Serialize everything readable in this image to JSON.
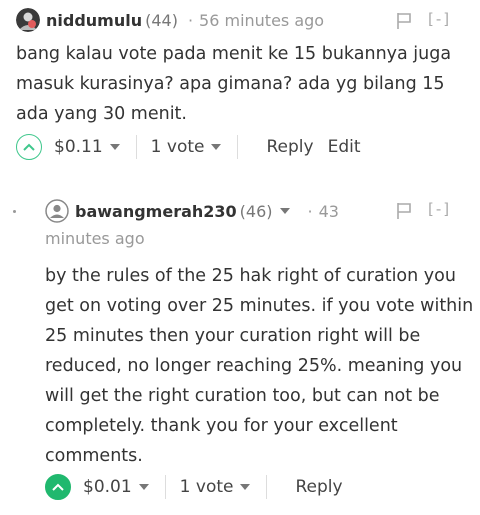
{
  "comments": [
    {
      "author": "niddumulu",
      "reputation": "(44)",
      "separator": "·",
      "time": "56 minutes ago",
      "collapse": "[-]",
      "body": [
        "bang kalau vote pada menit ke 15 bukannya juga",
        "masuk kurasinya? apa gimana? ada yg bilang 15",
        "ada yang 30 menit."
      ],
      "payout": "$0.11",
      "votes": "1 vote",
      "actions": [
        "Reply",
        "Edit"
      ]
    },
    {
      "author": "bawangmerah230",
      "reputation": "(46)",
      "separator": "·",
      "time_part1": "43",
      "time_part2": "minutes ago",
      "collapse": "[-]",
      "body": [
        "by the rules of the 25 hak right of curation you",
        "get on voting over 25 minutes. if you vote within",
        "25 minutes then your curation right will be",
        "reduced, no longer reaching 25%. meaning you",
        "will get the right curation too, but can not be",
        "completely. thank you for your excellent",
        "comments."
      ],
      "payout": "$0.01",
      "votes": "1 vote",
      "actions": [
        "Reply"
      ]
    }
  ],
  "colors": {
    "upvote_outline": "#3fc78c",
    "upvote_filled": "#20b86e",
    "text": "#333333",
    "muted": "#999999"
  },
  "icons": {
    "upvote": "chevron-up-icon",
    "dropdown": "caret-down-icon",
    "flag": "flag-icon",
    "avatar": "user-avatar-icon"
  }
}
